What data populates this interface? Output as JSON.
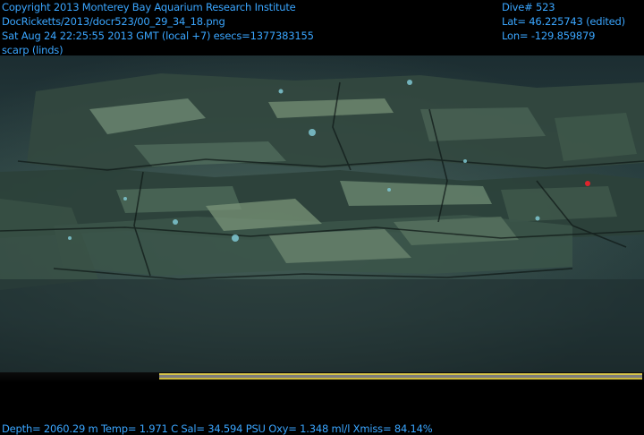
{
  "overlay": {
    "top_left": [
      "Copyright 2013 Monterey Bay Aquarium Research Institute",
      "DocRicketts/2013/docr523/00_29_34_18.png",
      "Sat Aug 24 22:25:55 2013 GMT (local +7)  esecs=1377383155",
      "scarp (linds)"
    ],
    "top_right": [
      "Dive# 523",
      "Lat= 46.225743 (edited)",
      "Lon= -129.859879"
    ],
    "bottom": "Depth= 2060.29 m  Temp= 1.971 C  Sal= 34.594 PSU  Oxy= 1.348 ml/l  Xmiss= 84.14%"
  },
  "colors": {
    "overlay_text": "#3aa6ff",
    "water": "#24393a",
    "rock": "#4f6a5e",
    "sediment": "#6f8a70",
    "vehicle_bar": "#d6c44a"
  },
  "scene": {
    "subject": "seafloor scarp with layered volcanic rock ledges",
    "foreground": "ROV sample tray edge with yellow rim"
  }
}
